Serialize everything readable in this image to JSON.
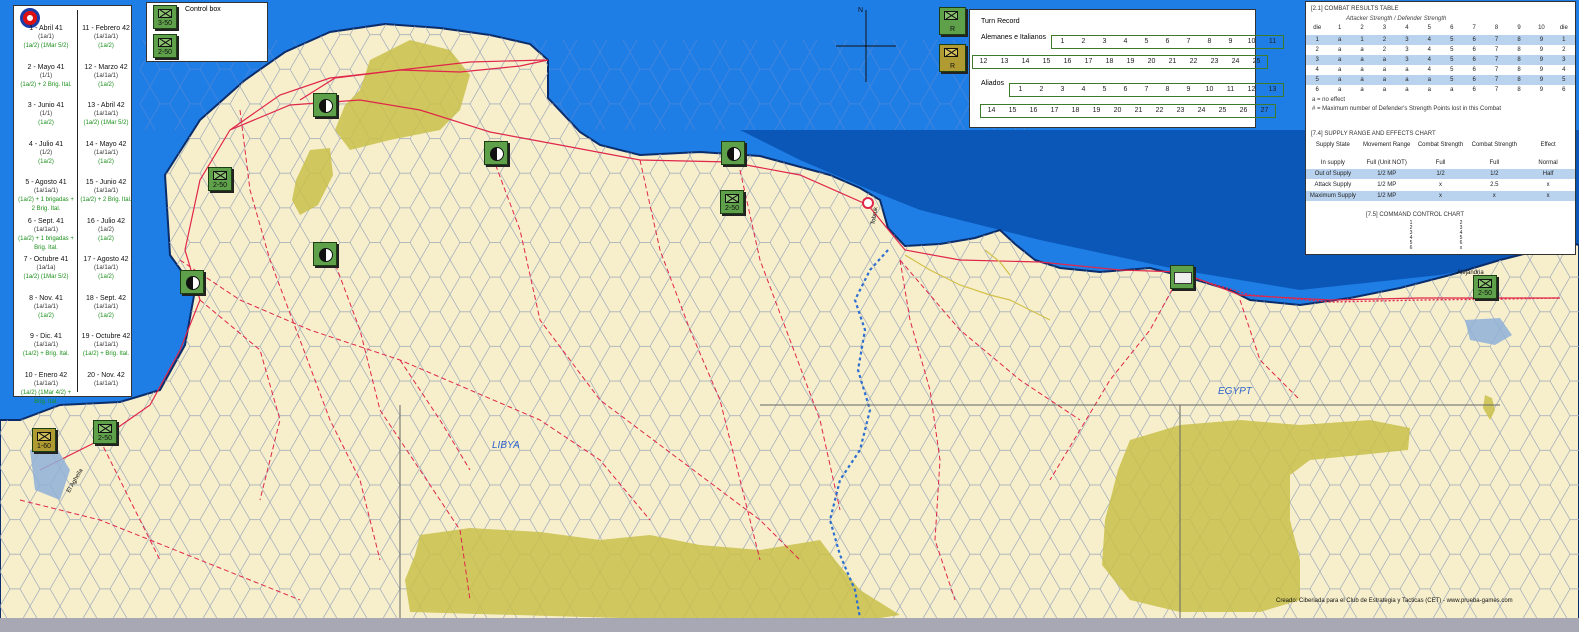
{
  "turn_track": {
    "left_column": [
      {
        "name": "1 - Abril 41",
        "sub": "(1a/1)",
        "note": "(1a/2) (1Mar 5/2)"
      },
      {
        "name": "2 - Mayo 41",
        "sub": "(1/1)",
        "note": "(1a/2) + 2 Brig. Ital."
      },
      {
        "name": "3 - Junio 41",
        "sub": "(1/1)",
        "note": "(1a/2)"
      },
      {
        "name": "4 - Julio 41",
        "sub": "(1/2)",
        "note": "(1a/2)"
      },
      {
        "name": "5 - Agosto 41",
        "sub": "(1a/1a/1)",
        "note": "(1a/2) + 1 brigadas + 2 Brig. Ital."
      },
      {
        "name": "6 - Sept. 41",
        "sub": "(1a/1a/1)",
        "note": "(1a/2) + 1 brigadas + Brig. Ital."
      },
      {
        "name": "7 - Octubre 41",
        "sub": "(1a/1a)",
        "note": "(1a/2) (1Mar 5/2)"
      },
      {
        "name": "8 - Nov. 41",
        "sub": "(1a/1a/1)",
        "note": "(1a/2)"
      },
      {
        "name": "9 - Dic. 41",
        "sub": "(1a/1a/1)",
        "note": "(1a/2) + Brig. Ital."
      },
      {
        "name": "10 - Enero 42",
        "sub": "(1a/1a/1)",
        "note": "(1a/2) (1Mar 4/2) + Brig. Ital."
      }
    ],
    "right_column": [
      {
        "name": "11 - Febrero 42",
        "sub": "(1a/1a/1)",
        "note": "(1a/2)"
      },
      {
        "name": "12 - Marzo 42",
        "sub": "(1a/1a/1)",
        "note": "(1a/2)"
      },
      {
        "name": "13 - Abril 42",
        "sub": "(1a/1a/1)",
        "note": "(1a/2) (1Mar 5/2)"
      },
      {
        "name": "14 - Mayo 42",
        "sub": "(1a/1a/1)",
        "note": "(1a/2)"
      },
      {
        "name": "15 - Junio 42",
        "sub": "(1a/1a/1)",
        "note": "(1a/2) + 2 Brig. Ital."
      },
      {
        "name": "16 - Julio 42",
        "sub": "(1a/2)",
        "note": "(1a/2)"
      },
      {
        "name": "17 - Agosto 42",
        "sub": "(1a/1a/1)",
        "note": "(1a/2)"
      },
      {
        "name": "18 - Sept. 42",
        "sub": "(1a/1a/1)",
        "note": "(1a/2)"
      },
      {
        "name": "19 - Octubre 42",
        "sub": "(1a/1a/1)",
        "note": "(1a/2) + Brig. Ital."
      },
      {
        "name": "20 - Nov. 42",
        "sub": "(1a/1a/1)",
        "note": ""
      }
    ]
  },
  "reinforcement_box": {
    "title": "Control box",
    "units": [
      {
        "value": "3-50"
      },
      {
        "value": "2-50"
      }
    ]
  },
  "compass": {
    "north_label": "N"
  },
  "turn_record": {
    "title": "Turn Record",
    "axis_label": "Alemanes e Italianos",
    "allies_label": "Aliados",
    "row1": [
      "1",
      "2",
      "3",
      "4",
      "5",
      "6",
      "7",
      "8",
      "9",
      "10",
      "11"
    ],
    "row2": [
      "12",
      "13",
      "14",
      "15",
      "16",
      "17",
      "18",
      "19",
      "20",
      "21",
      "22",
      "23",
      "24",
      "25"
    ],
    "row3": [
      "1",
      "2",
      "3",
      "4",
      "5",
      "6",
      "7",
      "8",
      "9",
      "10",
      "11",
      "12",
      "13"
    ],
    "row4": [
      "14",
      "15",
      "16",
      "17",
      "18",
      "19",
      "20",
      "21",
      "22",
      "23",
      "24",
      "25",
      "26",
      "27"
    ]
  },
  "turn_record_counters": [
    {
      "value": "R"
    },
    {
      "value": "R"
    }
  ],
  "crt": {
    "title": "[2.1] COMBAT RESULTS TABLE",
    "subtitle": "Attacker Strength / Defender Strength",
    "header": [
      "die",
      "1",
      "2",
      "3",
      "4",
      "5",
      "6",
      "7",
      "8",
      "9",
      "10",
      "die"
    ],
    "rows": [
      [
        "1",
        "a",
        "1",
        "2",
        "3",
        "4",
        "5",
        "6",
        "7",
        "8",
        "9",
        "1"
      ],
      [
        "2",
        "a",
        "a",
        "2",
        "3",
        "4",
        "5",
        "6",
        "7",
        "8",
        "9",
        "2"
      ],
      [
        "3",
        "a",
        "a",
        "a",
        "3",
        "4",
        "5",
        "6",
        "7",
        "8",
        "9",
        "3"
      ],
      [
        "4",
        "a",
        "a",
        "a",
        "a",
        "4",
        "5",
        "6",
        "7",
        "8",
        "9",
        "4"
      ],
      [
        "5",
        "a",
        "a",
        "a",
        "a",
        "a",
        "5",
        "6",
        "7",
        "8",
        "9",
        "5"
      ],
      [
        "6",
        "a",
        "a",
        "a",
        "a",
        "a",
        "a",
        "6",
        "7",
        "8",
        "9",
        "6"
      ]
    ],
    "notes": [
      "a = no effect",
      "# = Maximum number of Defender's Strength Points lost in this Combat"
    ],
    "supply_title": "[7.4] SUPPLY RANGE AND EFFECTS CHART",
    "supply_header": [
      "Supply State",
      "Movement Range",
      "Combat Strength",
      "Combat Strength",
      "Effect"
    ],
    "supply_rows": [
      [
        "In supply",
        "Full (Unit NOT)",
        "Full",
        "Full",
        "Normal"
      ],
      [
        "Out of Supply",
        "1/2 MP",
        "1/2",
        "1/2",
        "Half"
      ],
      [
        "Attack Supply",
        "1/2 MP",
        "x",
        "2.5",
        "x"
      ],
      [
        "Maximum Supply",
        "1/2 MP",
        "x",
        "x",
        "x"
      ]
    ],
    "command_title": "[7.5] COMMAND CONTROL CHART",
    "command_rows": [
      [
        "1",
        "2"
      ],
      [
        "2",
        "3"
      ],
      [
        "3",
        "4"
      ],
      [
        "4",
        "5"
      ],
      [
        "5",
        "6"
      ],
      [
        "6",
        "x"
      ]
    ]
  },
  "map": {
    "libya_label": "LIBYA",
    "egypt_label": "EGYPT",
    "credit": "Creado: Ciberiada para el Club de Estrategia y Tacticas (CET) - www.prueba-games.com",
    "city_labels": {
      "tobruk": "Tobruk",
      "alexandria": "Alejandria",
      "el_agheila": "El Agheila"
    }
  },
  "map_units": [
    {
      "kind": "supply"
    },
    {
      "kind": "supply"
    },
    {
      "kind": "supply"
    },
    {
      "kind": "supply"
    },
    {
      "kind": "supply"
    },
    {
      "kind": "supply"
    },
    {
      "kind": "unit",
      "value": "2-50"
    },
    {
      "kind": "unit",
      "value": "2-50"
    },
    {
      "kind": "unit",
      "value": "2-50"
    },
    {
      "kind": "unit",
      "value": "1-60"
    },
    {
      "kind": "unit",
      "value": "2-50"
    },
    {
      "kind": "fort"
    }
  ]
}
